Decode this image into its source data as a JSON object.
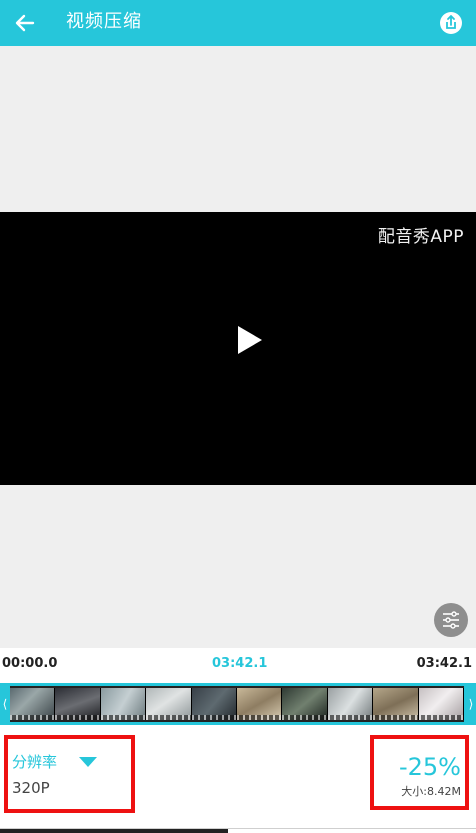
{
  "header": {
    "title": "视频压缩",
    "back_icon": "arrow-left-icon",
    "share_icon": "share-icon"
  },
  "video": {
    "watermark": "配音秀APP",
    "play_icon": "play-icon",
    "settings_icon": "sliders-icon"
  },
  "timeline": {
    "start_time": "00:00.0",
    "current_time": "03:42.1",
    "end_time": "03:42.1",
    "left_handle": "⟨",
    "right_handle": "⟩"
  },
  "resolution": {
    "label": "分辨率",
    "value": "320P",
    "dropdown_icon": "triangle-down-icon"
  },
  "size": {
    "percent_change": "-25%",
    "file_size": "大小:8.42M"
  },
  "colors": {
    "accent": "#26c6da",
    "highlight_border": "#ee1111",
    "video_bg": "#000000",
    "preview_bg": "#efefef"
  }
}
